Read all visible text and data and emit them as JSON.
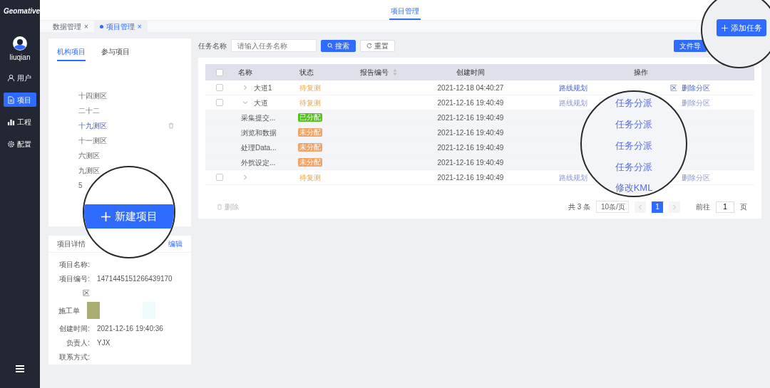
{
  "sidebar": {
    "logo": "Geomative",
    "user": "liuqian",
    "items": [
      {
        "label": "用户",
        "selected": false
      },
      {
        "label": "项目",
        "selected": true
      },
      {
        "label": "工程",
        "selected": false
      },
      {
        "label": "配置",
        "selected": false
      }
    ]
  },
  "header": {
    "tabs": [
      {
        "label": "项目管理",
        "selected": true
      }
    ]
  },
  "breadcrumbs": [
    {
      "label": "数据管理",
      "close": "×",
      "selected": false
    },
    {
      "label": "项目管理",
      "close": "×",
      "selected": true
    }
  ],
  "add_task_button": "添加任务",
  "project_panel": {
    "tabs": [
      {
        "label": "机构项目",
        "selected": true
      },
      {
        "label": "参与项目",
        "selected": false
      }
    ],
    "items": [
      {
        "label": "十四测区",
        "selected": false
      },
      {
        "label": "二十二",
        "selected": false
      },
      {
        "label": "十九测区",
        "selected": true
      },
      {
        "label": "十一测区",
        "selected": false
      },
      {
        "label": "六测区",
        "selected": false
      },
      {
        "label": "九测区",
        "selected": false
      },
      {
        "label": "5",
        "selected": false
      }
    ],
    "new_button": "新建项目"
  },
  "details": {
    "title": "项目详情",
    "edit": "编辑",
    "fields": [
      {
        "label": "项目名称:",
        "kind": "text"
      },
      {
        "label": "项目编号:",
        "kind": "text",
        "value": "1471445151266439170"
      },
      {
        "label": "区",
        "kind": "text"
      },
      {
        "label": "施工单",
        "kind": "swatches",
        "swatches": [
          {
            "color": "#a9ad6f"
          },
          {
            "color": "#eefcfd"
          }
        ]
      },
      {
        "label": "创建时间:",
        "kind": "text",
        "value": "2021-12-16 19:40:36"
      },
      {
        "label": "负责人:",
        "kind": "text",
        "value": "YJX"
      },
      {
        "label": "联系方式:",
        "kind": "text"
      }
    ]
  },
  "filter": {
    "label": "任务名称",
    "placeholder": "请输入任务名称",
    "search": "搜索",
    "reset": "重置",
    "import": "文件导"
  },
  "table": {
    "select_all": {
      "checked": false
    },
    "columns": [
      "名称",
      "状态",
      "报告编号",
      "创建时间",
      "操作"
    ],
    "rows": [
      {
        "kind": "parent",
        "checked": false,
        "expanded": false,
        "name": "大道1",
        "status": "待复测",
        "created": "2021-12-18 04:40:27",
        "ops": [
          "路线规划",
          "区",
          "删除分区"
        ]
      },
      {
        "kind": "parent",
        "checked": false,
        "expanded": true,
        "name": "大道",
        "status": "待复测",
        "created": "2021-12-16 19:40:49",
        "ops": [
          "路线规划",
          "删除分区"
        ]
      },
      {
        "kind": "child",
        "name": "采集提交...",
        "status": "已分配",
        "color": "#52c41a",
        "created": "2021-12-16 19:40:49"
      },
      {
        "kind": "child",
        "name": "浏览和数据",
        "status": "未分配",
        "color": "#f0a366",
        "created": "2021-12-16 19:40:49"
      },
      {
        "kind": "child",
        "name": "处理Data...",
        "status": "未分配",
        "color": "#f0a366",
        "created": "2021-12-16 19:40:49"
      },
      {
        "kind": "child",
        "name": "外扰设定...",
        "status": "未分配",
        "color": "#f0a366",
        "created": "2021-12-16 19:40:49"
      },
      {
        "kind": "parent",
        "checked": false,
        "expanded": false,
        "status": "待复测",
        "created": "2021-12-16 19:40:49",
        "ops": [
          "路线规划",
          "删除分区"
        ]
      }
    ]
  },
  "footer": {
    "delete": "删除",
    "total": "共 3 条",
    "page_size": "10条/页",
    "pages": [
      {
        "label": "1",
        "selected": true
      }
    ],
    "goto": "前往",
    "goto_value": "1",
    "page_suffix": "页"
  },
  "lens_actions": [
    "任务分派",
    "任务分派",
    "任务分派",
    "任务分派",
    "修改KML"
  ]
}
